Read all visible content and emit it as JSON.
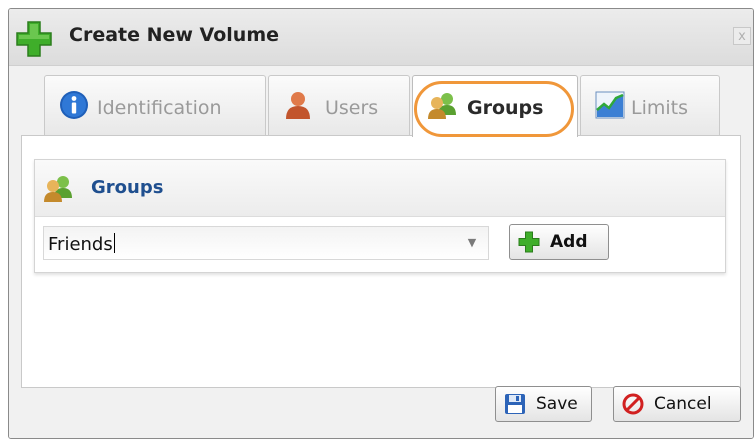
{
  "dialog": {
    "title": "Create New Volume",
    "close_label": "x"
  },
  "tabs": [
    {
      "label": "Identification",
      "icon": "info-icon",
      "active": false
    },
    {
      "label": "Users",
      "icon": "user-icon",
      "active": false
    },
    {
      "label": "Groups",
      "icon": "groups-icon",
      "active": true
    },
    {
      "label": "Limits",
      "icon": "chart-icon",
      "active": false
    }
  ],
  "groups_panel": {
    "title": "Groups",
    "combo_value": "Friends",
    "add_label": "Add"
  },
  "footer": {
    "save_label": "Save",
    "cancel_label": "Cancel"
  },
  "colors": {
    "accent_green": "#3fae2a",
    "highlight_orange": "#f0973a",
    "title_blue": "#1f4f8f"
  }
}
